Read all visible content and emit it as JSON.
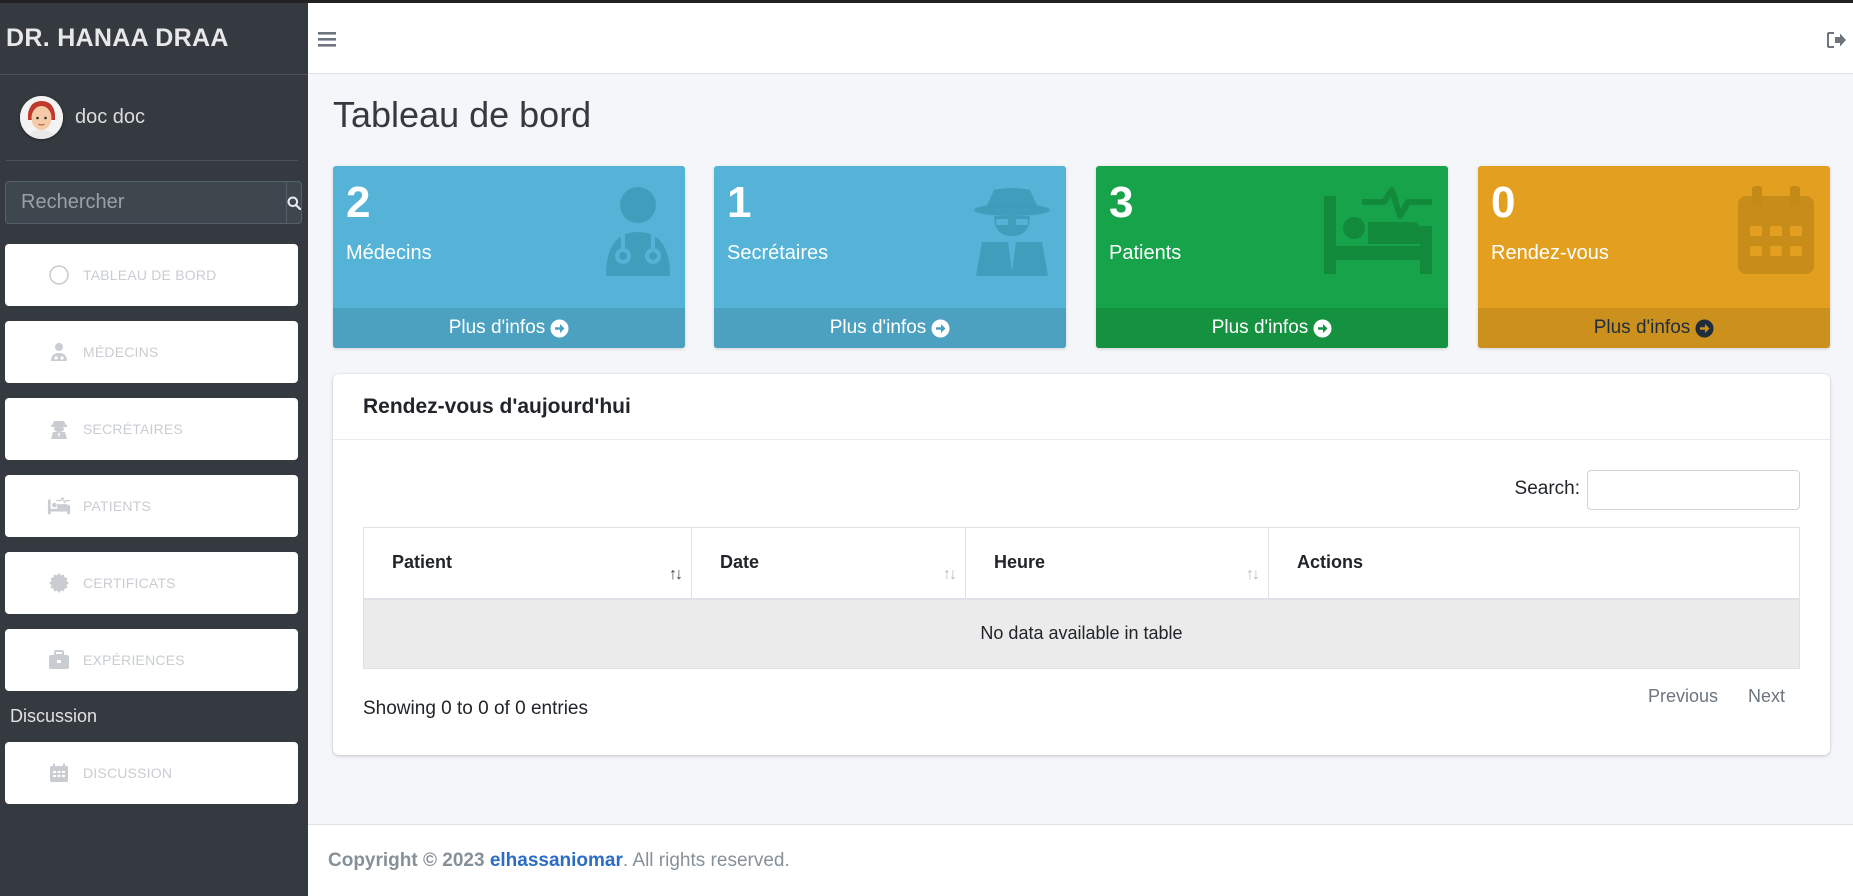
{
  "sidebar": {
    "brand": "DR. HANAA DRAA",
    "user_name": "doc doc",
    "search_placeholder": "Rechercher",
    "items": [
      {
        "label": "TABLEAU DE BORD",
        "icon": "circle-icon"
      },
      {
        "label": "MÉDECINS",
        "icon": "user-md-icon"
      },
      {
        "label": "SECRÉTAIRES",
        "icon": "user-secret-icon"
      },
      {
        "label": "PATIENTS",
        "icon": "bed-pulse-icon"
      },
      {
        "label": "CERTIFICATS",
        "icon": "certificate-icon"
      },
      {
        "label": "EXPÉRIENCES",
        "icon": "briefcase-icon"
      }
    ],
    "section_header": "Discussion",
    "discussion_item": {
      "label": "DISCUSSION",
      "icon": "calendar-icon"
    }
  },
  "page": {
    "title": "Tableau de bord"
  },
  "stats": [
    {
      "count": "2",
      "label": "Médecins",
      "more": "Plus d'infos",
      "color": "#54b3d6"
    },
    {
      "count": "1",
      "label": "Secrétaires",
      "more": "Plus d'infos",
      "color": "#54b3d6"
    },
    {
      "count": "3",
      "label": "Patients",
      "more": "Plus d'infos",
      "color": "#16a34a"
    },
    {
      "count": "0",
      "label": "Rendez-vous",
      "more": "Plus d'infos",
      "color": "#e3a020"
    }
  ],
  "appointments": {
    "title": "Rendez-vous d'aujourd'hui",
    "search_label": "Search:",
    "columns": [
      "Patient",
      "Date",
      "Heure",
      "Actions"
    ],
    "empty_message": "No data available in table",
    "info": "Showing 0 to 0 of 0 entries",
    "prev": "Previous",
    "next": "Next"
  },
  "footer": {
    "copyright": "Copyright © 2023",
    "author": "elhassaniomar",
    "rights": ". All rights reserved."
  }
}
